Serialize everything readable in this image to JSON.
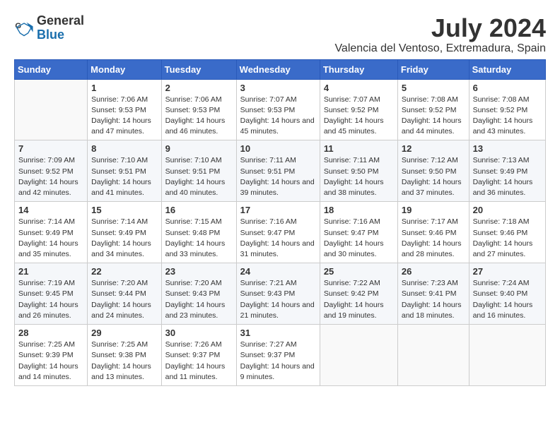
{
  "logo": {
    "general": "General",
    "blue": "Blue"
  },
  "title": {
    "month_year": "July 2024",
    "location": "Valencia del Ventoso, Extremadura, Spain"
  },
  "header": {
    "days": [
      "Sunday",
      "Monday",
      "Tuesday",
      "Wednesday",
      "Thursday",
      "Friday",
      "Saturday"
    ]
  },
  "weeks": [
    {
      "cells": [
        {
          "day": null
        },
        {
          "day": "1",
          "sunrise": "7:06 AM",
          "sunset": "9:53 PM",
          "daylight": "14 hours and 47 minutes."
        },
        {
          "day": "2",
          "sunrise": "7:06 AM",
          "sunset": "9:53 PM",
          "daylight": "14 hours and 46 minutes."
        },
        {
          "day": "3",
          "sunrise": "7:07 AM",
          "sunset": "9:53 PM",
          "daylight": "14 hours and 45 minutes."
        },
        {
          "day": "4",
          "sunrise": "7:07 AM",
          "sunset": "9:52 PM",
          "daylight": "14 hours and 45 minutes."
        },
        {
          "day": "5",
          "sunrise": "7:08 AM",
          "sunset": "9:52 PM",
          "daylight": "14 hours and 44 minutes."
        },
        {
          "day": "6",
          "sunrise": "7:08 AM",
          "sunset": "9:52 PM",
          "daylight": "14 hours and 43 minutes."
        }
      ]
    },
    {
      "cells": [
        {
          "day": "7",
          "sunrise": "7:09 AM",
          "sunset": "9:52 PM",
          "daylight": "14 hours and 42 minutes."
        },
        {
          "day": "8",
          "sunrise": "7:10 AM",
          "sunset": "9:51 PM",
          "daylight": "14 hours and 41 minutes."
        },
        {
          "day": "9",
          "sunrise": "7:10 AM",
          "sunset": "9:51 PM",
          "daylight": "14 hours and 40 minutes."
        },
        {
          "day": "10",
          "sunrise": "7:11 AM",
          "sunset": "9:51 PM",
          "daylight": "14 hours and 39 minutes."
        },
        {
          "day": "11",
          "sunrise": "7:11 AM",
          "sunset": "9:50 PM",
          "daylight": "14 hours and 38 minutes."
        },
        {
          "day": "12",
          "sunrise": "7:12 AM",
          "sunset": "9:50 PM",
          "daylight": "14 hours and 37 minutes."
        },
        {
          "day": "13",
          "sunrise": "7:13 AM",
          "sunset": "9:49 PM",
          "daylight": "14 hours and 36 minutes."
        }
      ]
    },
    {
      "cells": [
        {
          "day": "14",
          "sunrise": "7:14 AM",
          "sunset": "9:49 PM",
          "daylight": "14 hours and 35 minutes."
        },
        {
          "day": "15",
          "sunrise": "7:14 AM",
          "sunset": "9:49 PM",
          "daylight": "14 hours and 34 minutes."
        },
        {
          "day": "16",
          "sunrise": "7:15 AM",
          "sunset": "9:48 PM",
          "daylight": "14 hours and 33 minutes."
        },
        {
          "day": "17",
          "sunrise": "7:16 AM",
          "sunset": "9:47 PM",
          "daylight": "14 hours and 31 minutes."
        },
        {
          "day": "18",
          "sunrise": "7:16 AM",
          "sunset": "9:47 PM",
          "daylight": "14 hours and 30 minutes."
        },
        {
          "day": "19",
          "sunrise": "7:17 AM",
          "sunset": "9:46 PM",
          "daylight": "14 hours and 28 minutes."
        },
        {
          "day": "20",
          "sunrise": "7:18 AM",
          "sunset": "9:46 PM",
          "daylight": "14 hours and 27 minutes."
        }
      ]
    },
    {
      "cells": [
        {
          "day": "21",
          "sunrise": "7:19 AM",
          "sunset": "9:45 PM",
          "daylight": "14 hours and 26 minutes."
        },
        {
          "day": "22",
          "sunrise": "7:20 AM",
          "sunset": "9:44 PM",
          "daylight": "14 hours and 24 minutes."
        },
        {
          "day": "23",
          "sunrise": "7:20 AM",
          "sunset": "9:43 PM",
          "daylight": "14 hours and 23 minutes."
        },
        {
          "day": "24",
          "sunrise": "7:21 AM",
          "sunset": "9:43 PM",
          "daylight": "14 hours and 21 minutes."
        },
        {
          "day": "25",
          "sunrise": "7:22 AM",
          "sunset": "9:42 PM",
          "daylight": "14 hours and 19 minutes."
        },
        {
          "day": "26",
          "sunrise": "7:23 AM",
          "sunset": "9:41 PM",
          "daylight": "14 hours and 18 minutes."
        },
        {
          "day": "27",
          "sunrise": "7:24 AM",
          "sunset": "9:40 PM",
          "daylight": "14 hours and 16 minutes."
        }
      ]
    },
    {
      "cells": [
        {
          "day": "28",
          "sunrise": "7:25 AM",
          "sunset": "9:39 PM",
          "daylight": "14 hours and 14 minutes."
        },
        {
          "day": "29",
          "sunrise": "7:25 AM",
          "sunset": "9:38 PM",
          "daylight": "14 hours and 13 minutes."
        },
        {
          "day": "30",
          "sunrise": "7:26 AM",
          "sunset": "9:37 PM",
          "daylight": "14 hours and 11 minutes."
        },
        {
          "day": "31",
          "sunrise": "7:27 AM",
          "sunset": "9:37 PM",
          "daylight": "14 hours and 9 minutes."
        },
        {
          "day": null
        },
        {
          "day": null
        },
        {
          "day": null
        }
      ]
    }
  ]
}
